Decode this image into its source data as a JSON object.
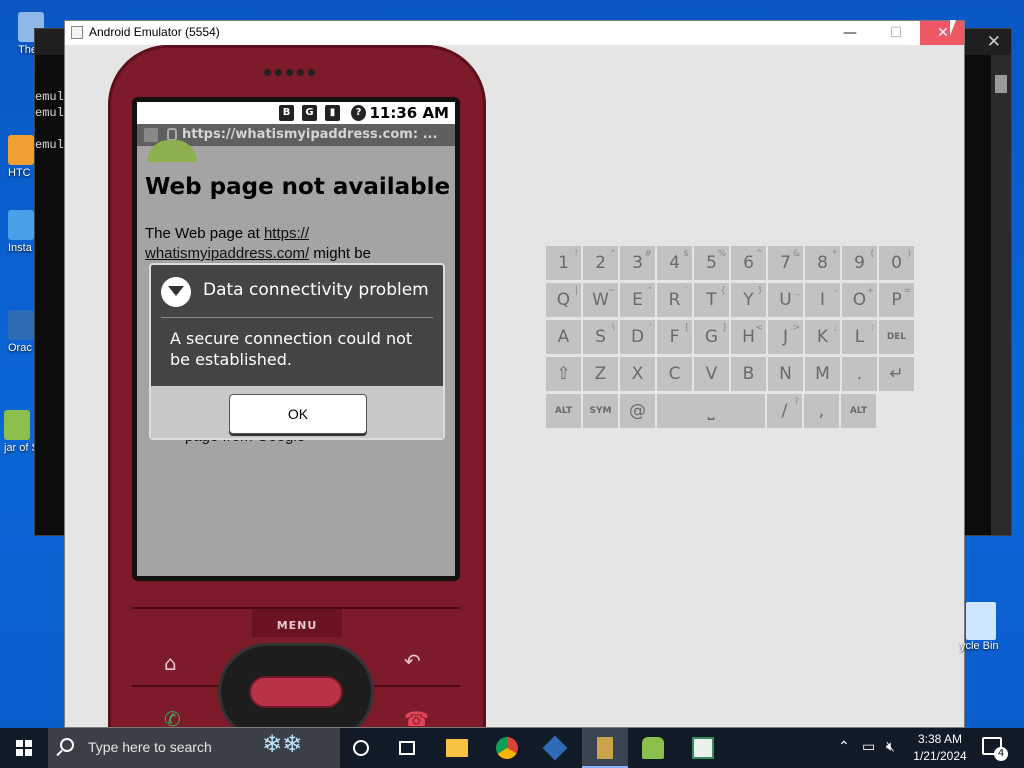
{
  "desktop": {
    "icons": [
      {
        "label": "Themul",
        "color": "#8fb8e8"
      },
      {
        "label": "emul",
        "color": "#444"
      },
      {
        "label": "emul",
        "color": "#444"
      },
      {
        "label": "emul",
        "color": "#444"
      },
      {
        "label": "HTC",
        "color": "#f0a030"
      },
      {
        "label": "Insta HA",
        "color": "#4aa0e8"
      },
      {
        "label": "Orac Virtu",
        "color": "#2d6bb5"
      },
      {
        "label": "jar of Sho",
        "color": "#8cc04d"
      }
    ],
    "recycle_bin_label": "ycle Bin"
  },
  "emulator": {
    "title": "Android Emulator (5554)",
    "minimize": "—",
    "maximize": "☐",
    "close": "✕"
  },
  "phone": {
    "status": {
      "bluetooth": "B",
      "network": "G",
      "signal": "▮",
      "alert": "?",
      "time": "11:36 AM"
    },
    "url": "https://whatismyipaddress.com: ...",
    "page": {
      "heading": "Web page not available",
      "body_prefix": "The Web page at ",
      "link_line1": "https://",
      "link_line2": "whatismyipaddress.com/",
      "body_suffix": " might be",
      "partial_bottom": "page from Google"
    },
    "dialog": {
      "title": "Data connectivity problem",
      "message": "A secure connection could not be established.",
      "ok": "OK"
    },
    "menu_label": "MENU"
  },
  "keyboard": {
    "rows": [
      [
        {
          "k": "1",
          "s": "!"
        },
        {
          "k": "2",
          "s": "\""
        },
        {
          "k": "3",
          "s": "#"
        },
        {
          "k": "4",
          "s": "$"
        },
        {
          "k": "5",
          "s": "%"
        },
        {
          "k": "6",
          "s": "^"
        },
        {
          "k": "7",
          "s": "&"
        },
        {
          "k": "8",
          "s": "*"
        },
        {
          "k": "9",
          "s": "("
        },
        {
          "k": "0",
          "s": ")"
        }
      ],
      [
        {
          "k": "Q",
          "s": "|"
        },
        {
          "k": "W",
          "s": "~"
        },
        {
          "k": "E",
          "s": "\""
        },
        {
          "k": "R",
          "s": "`"
        },
        {
          "k": "T",
          "s": "{"
        },
        {
          "k": "Y",
          "s": "}"
        },
        {
          "k": "U",
          "s": "_"
        },
        {
          "k": "I",
          "s": "-"
        },
        {
          "k": "O",
          "s": "+"
        },
        {
          "k": "P",
          "s": "="
        }
      ],
      [
        {
          "k": "A",
          "s": ""
        },
        {
          "k": "S",
          "s": "\\"
        },
        {
          "k": "D",
          "s": "'"
        },
        {
          "k": "F",
          "s": "["
        },
        {
          "k": "G",
          "s": "]"
        },
        {
          "k": "H",
          "s": "<"
        },
        {
          "k": "J",
          "s": ">"
        },
        {
          "k": "K",
          "s": ";"
        },
        {
          "k": "L",
          "s": ":"
        },
        {
          "k": "DEL",
          "s": ""
        }
      ],
      [
        {
          "k": "⇧",
          "s": ""
        },
        {
          "k": "Z",
          "s": ""
        },
        {
          "k": "X",
          "s": ""
        },
        {
          "k": "C",
          "s": ""
        },
        {
          "k": "V",
          "s": ""
        },
        {
          "k": "B",
          "s": ""
        },
        {
          "k": "N",
          "s": ""
        },
        {
          "k": "M",
          "s": ""
        },
        {
          "k": ".",
          "s": ""
        },
        {
          "k": "↵",
          "s": ""
        }
      ],
      [
        {
          "k": "ALT",
          "s": ""
        },
        {
          "k": "SYM",
          "s": ""
        },
        {
          "k": "@",
          "s": ""
        },
        {
          "k": "⎵",
          "s": ""
        },
        {
          "k": "/",
          "s": "?"
        },
        {
          "k": ",",
          "s": ""
        },
        {
          "k": "ALT",
          "s": ""
        }
      ]
    ]
  },
  "taskbar": {
    "search_placeholder": "Type here to search",
    "apps": [
      {
        "name": "cortana",
        "active": false
      },
      {
        "name": "task-view",
        "active": false
      },
      {
        "name": "file-explorer",
        "active": false
      },
      {
        "name": "chrome",
        "active": false
      },
      {
        "name": "virtualbox",
        "active": false
      },
      {
        "name": "emulator",
        "active": true
      },
      {
        "name": "android",
        "active": false
      },
      {
        "name": "notepad",
        "active": false
      }
    ],
    "time": "3:38 AM",
    "date": "1/21/2024",
    "notification_count": "4"
  },
  "colors": {
    "phone_body": "#7d1b2a",
    "desktop_bg": "#0a67d8",
    "taskbar": "#111b28",
    "close_red": "#e81123"
  }
}
